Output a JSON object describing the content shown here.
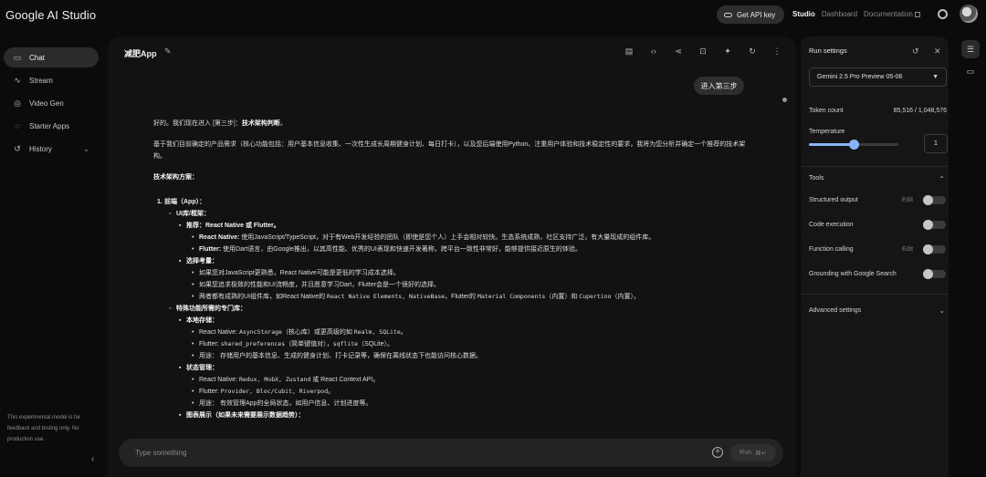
{
  "header": {
    "brand": "Google AI Studio",
    "api_key_label": "Get API key",
    "nav": [
      "Studio",
      "Dashboard",
      "Documentation"
    ]
  },
  "sidebar": {
    "items": [
      {
        "label": "Chat",
        "icon": "chat-icon"
      },
      {
        "label": "Stream",
        "icon": "stream-icon"
      },
      {
        "label": "Video Gen",
        "icon": "video-icon"
      },
      {
        "label": "Starter Apps",
        "icon": "apps-icon"
      },
      {
        "label": "History",
        "icon": "history-icon"
      }
    ],
    "disclaimer": "This experimental model is for feedback and testing only. No production use."
  },
  "main": {
    "title": "减肥App",
    "user_message": "进入第三步",
    "response": {
      "intro_prefix": "好的。我们现在进入 [第三步]：",
      "intro_bold": "技术架构判断",
      "intro_suffix": "。",
      "para": "基于我们目前确定的产品需求（核心功能包括：用户基本信息收集、一次性生成长周期健身计划、每日打卡），以及您后端使用Python、注重用户体验和技术稳定性的要求，我将为您分析并确定一个推荐的技术架构。",
      "section_title": "技术架构方案：",
      "l1_frontend": "前端（App）：",
      "ui_lib": "UI库/框架：",
      "recommend_label": "推荐：",
      "recommend_val": "React Native 或 Flutter。",
      "rn_label": "React Native:",
      "rn_text": " 使用JavaScript/TypeScript，对于有Web开发经验的团队（即使是您个人）上手会相对较快。生态系统成熟，社区支持广泛，有大量现成的组件库。",
      "flutter_label": "Flutter:",
      "flutter_text": " 使用Dart语言，由Google推出，以其高性能、优秀的UI表现和快速开发著称。跨平台一致性非常好，能够提供接近原生的体验。",
      "consider_label": "选择考量：",
      "consider_1": "如果您对JavaScript更熟悉，React Native可能是更低的学习成本选择。",
      "consider_2": "如果您追求极致的性能和UI流畅度，并且愿意学习Dart，Flutter会是一个很好的选择。",
      "consider_3a": "两者都有成熟的UI组件库，如React Native的 ",
      "consider_3b": "React Native Elements, NativeBase",
      "consider_3c": "，Flutter的 ",
      "consider_3d": "Material Components",
      "consider_3e": "（内置）和 ",
      "consider_3f": "Cupertino",
      "consider_3g": "（内置）。",
      "special_libs": "特殊功能所需的专门库：",
      "local_storage": "本地存储：",
      "ls_rn_a": "React Native: ",
      "ls_rn_b": "AsyncStorage",
      "ls_rn_c": "（核心库）或更高级的如 ",
      "ls_rn_d": "Realm, SQLite",
      "ls_rn_e": "。",
      "ls_fl_a": "Flutter: ",
      "ls_fl_b": "shared_preferences",
      "ls_fl_c": "（简单键值对），",
      "ls_fl_d": "sqflite",
      "ls_fl_e": "（SQLite）。",
      "ls_use": "用途： 存储用户的基本信息、生成的健身计划、打卡记录等，确保在离线状态下也能访问核心数据。",
      "state_mgmt": "状态管理：",
      "sm_rn_a": "React Native: ",
      "sm_rn_b": "Redux, MobX, Zustand",
      "sm_rn_c": " 或 React Context API。",
      "sm_fl_a": "Flutter: ",
      "sm_fl_b": "Provider, Bloc/Cubit, Riverpod",
      "sm_fl_c": "。",
      "sm_use": "用途： 有效管理App的全局状态，如用户信息、计划进度等。",
      "cut_line": "图表展示（如果未来需要展示数据趋势）："
    },
    "input_placeholder": "Type something",
    "run_label": "Run",
    "run_shortcut": "⌘↵"
  },
  "settings": {
    "title": "Run settings",
    "model": "Gemini 2.5 Pro Preview 05-06",
    "token_label": "Token count",
    "token_value": "85,516 / 1,048,576",
    "temperature_label": "Temperature",
    "temperature_value": "1",
    "temperature_fraction": 0.5,
    "tools_label": "Tools",
    "tools": [
      {
        "label": "Structured output",
        "edit": "Edit"
      },
      {
        "label": "Code execution",
        "edit": ""
      },
      {
        "label": "Function calling",
        "edit": "Edit"
      },
      {
        "label": "Grounding with Google Search",
        "edit": ""
      }
    ],
    "advanced_label": "Advanced settings"
  },
  "colors": {
    "accent": "#8ab4f8",
    "background": "#0b0b0c",
    "panel": "#121213"
  }
}
